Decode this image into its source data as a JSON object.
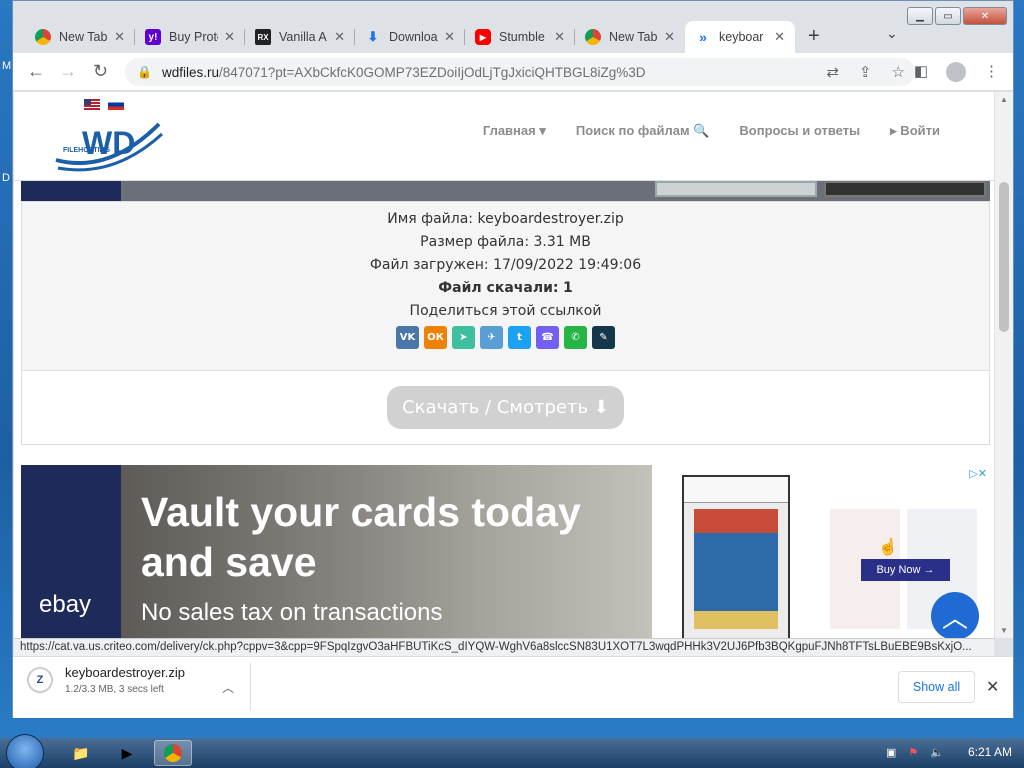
{
  "browser": {
    "tabs": [
      {
        "label": "New Tab",
        "icon": "chrome-icon"
      },
      {
        "label": "Buy Proto",
        "icon": "yahoo-icon"
      },
      {
        "label": "Vanilla A",
        "icon": "rx-icon"
      },
      {
        "label": "Downloa",
        "icon": "download-icon"
      },
      {
        "label": "Stumble",
        "icon": "youtube-icon"
      },
      {
        "label": "New Tab",
        "icon": "chrome-icon"
      },
      {
        "label": "keyboar",
        "icon": "wdfiles-icon",
        "active": true
      }
    ],
    "url_host": "wdfiles.ru",
    "url_path": "/847071?pt=AXbCkfcK0GOMP73EZDoiIjOdLjTgJxiciQHTBGL8iZg%3D"
  },
  "site": {
    "logo_text": "WD",
    "logo_sub": "FILEHOSTING",
    "nav": {
      "home": "Главная ▾",
      "search": "Поиск по файлам 🔍",
      "faq": "Вопросы и ответы",
      "login": "▸ Войти"
    }
  },
  "file_info": {
    "name_label": "Имя файла:",
    "name_value": "keyboardestroyer.zip",
    "size_label": "Размер файла:",
    "size_value": "3.31 MB",
    "uploaded_label": "Файл загружен:",
    "uploaded_value": "17/09/2022 19:49:06",
    "downloads_label": "Файл скачали:",
    "downloads_value": "1",
    "share_text": "Поделиться этой ссылкой",
    "share_icons": [
      {
        "name": "vk-share-icon",
        "glyph": "VK",
        "color": "#4a76a8"
      },
      {
        "name": "ok-share-icon",
        "glyph": "ОК",
        "color": "#ee8208"
      },
      {
        "name": "send-share-icon",
        "glyph": "➤",
        "color": "#3dbfa0"
      },
      {
        "name": "telegram-share-icon",
        "glyph": "✈",
        "color": "#5a9fd4"
      },
      {
        "name": "twitter-share-icon",
        "glyph": "t",
        "color": "#1da1f2"
      },
      {
        "name": "viber-share-icon",
        "glyph": "☎",
        "color": "#7360f2"
      },
      {
        "name": "whatsapp-share-icon",
        "glyph": "✆",
        "color": "#25b445"
      },
      {
        "name": "lj-share-icon",
        "glyph": "✎",
        "color": "#15374c"
      }
    ]
  },
  "download_button": "Скачать / Смотреть ⬇",
  "ad": {
    "brand": "ebay",
    "headline": "Vault your cards today and save",
    "sub": "No sales tax on transactions",
    "cta": "Buy Now →",
    "adchoices": "▷✕"
  },
  "status_url": "https://cat.va.us.criteo.com/delivery/ck.php?cppv=3&cpp=9FSpqIzgvO3aHFBUTiKcS_dIYQW-WghV6a8slccSN83U1XOT7L3wqdPHHk3V2UJ6Pfb3BQKgpuFJNh8TFTsLBuEBE9BsKxjO...",
  "download_shelf": {
    "file_name": "keyboardestroyer.zip",
    "progress_text": "1.2/3.3 MB, 3 secs left",
    "show_all": "Show all"
  },
  "taskbar": {
    "clock": "6:21 AM"
  },
  "desktop": {
    "edge_label_top": "M",
    "edge_label_mid": "D"
  }
}
